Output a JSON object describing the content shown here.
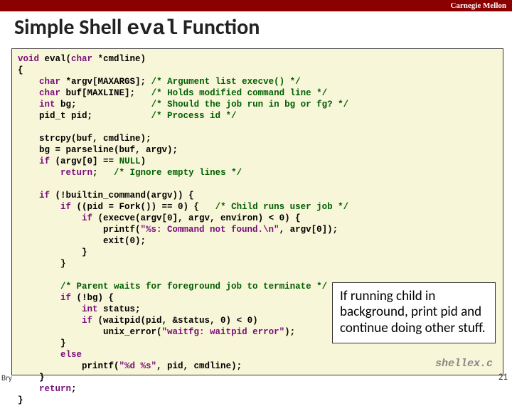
{
  "brand": "Carnegie Mellon",
  "title_pre": "Simple Shell ",
  "title_mono": "eval",
  "title_post": " Function",
  "code": {
    "l01a": "void",
    "l01b": " eval(",
    "l01c": "char",
    "l01d": " *cmdline)",
    "l02": "{",
    "l03a": "    ",
    "l03b": "char",
    "l03c": " *argv[MAXARGS]; ",
    "l03d": "/* Argument list execve() */",
    "l04a": "    ",
    "l04b": "char",
    "l04c": " buf[MAXLINE];   ",
    "l04d": "/* Holds modified command line */",
    "l05a": "    ",
    "l05b": "int",
    "l05c": " bg;              ",
    "l05d": "/* Should the job run in bg or fg? */",
    "l06a": "    pid_t pid;           ",
    "l06b": "/* Process id */",
    "l07": "",
    "l08": "    strcpy(buf, cmdline);",
    "l09": "    bg = parseline(buf, argv);",
    "l10a": "    ",
    "l10b": "if",
    "l10c": " (argv[0] == ",
    "l10d": "NULL",
    "l10e": ")",
    "l11a": "        ",
    "l11b": "return",
    "l11c": ";   ",
    "l11d": "/* Ignore empty lines */",
    "l12": "",
    "l13a": "    ",
    "l13b": "if",
    "l13c": " (!builtin_command(argv)) {",
    "l14a": "        ",
    "l14b": "if",
    "l14c": " ((pid = Fork()) == 0) {   ",
    "l14d": "/* Child runs user job */",
    "l15a": "            ",
    "l15b": "if",
    "l15c": " (execve(argv[0], argv, environ) < 0) {",
    "l16a": "                printf(",
    "l16b": "\"%s: Command not found.\\n\"",
    "l16c": ", argv[0]);",
    "l17": "                exit(0);",
    "l18": "            }",
    "l19": "        }",
    "l20": "",
    "l21a": "        ",
    "l21b": "/* Parent waits for foreground job to terminate */",
    "l22a": "        ",
    "l22b": "if",
    "l22c": " (!bg) {",
    "l23a": "            ",
    "l23b": "int",
    "l23c": " status;",
    "l24a": "            ",
    "l24b": "if",
    "l24c": " (waitpid(pid, &status, 0) < 0)",
    "l25a": "                unix_error(",
    "l25b": "\"waitfg: waitpid error\"",
    "l25c": ");",
    "l26": "        }",
    "l27a": "        ",
    "l27b": "else",
    "l28a": "            printf(",
    "l28b": "\"%d %s\"",
    "l28c": ", pid, cmdline);",
    "l29": "    }",
    "l30a": "    ",
    "l30b": "return",
    "l30c": ";",
    "l31": "}"
  },
  "overlay": "If running child in background, print pid and continue doing other stuff.",
  "srcfile": "shellex.c",
  "bry": "Bry",
  "pagenum": "21"
}
